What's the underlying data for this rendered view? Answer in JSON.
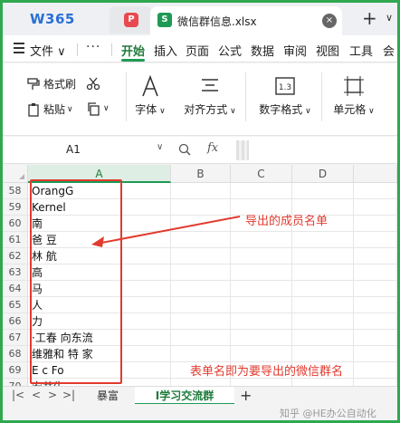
{
  "titlebar": {
    "logo": "W365",
    "pdf_badge": "P",
    "file_tab": {
      "badge": "S",
      "name": "微信群信息.xlsx",
      "close": "×"
    },
    "new_tab": "+",
    "more": "∨"
  },
  "menubar": {
    "file": "文件",
    "more": "···",
    "tabs": [
      "开始",
      "插入",
      "页面",
      "公式",
      "数据",
      "审阅",
      "视图",
      "工具"
    ],
    "active_tab": "开始",
    "extra": "会"
  },
  "ribbon": {
    "format_painter": "格式刷",
    "paste": "粘贴",
    "font": "字体",
    "align": "对齐方式",
    "number_format": "数字格式",
    "cell": "单元格"
  },
  "formula_bar": {
    "cell_ref": "A1",
    "fx": "fx"
  },
  "grid": {
    "columns": [
      "A",
      "B",
      "C",
      "D"
    ],
    "selected_column": "A",
    "rows": [
      {
        "n": "58",
        "a": "OrangG"
      },
      {
        "n": "59",
        "a": "Kernel"
      },
      {
        "n": "60",
        "a": "南"
      },
      {
        "n": "61",
        "a": "爸 豆"
      },
      {
        "n": "62",
        "a": "林 航"
      },
      {
        "n": "63",
        "a": "高"
      },
      {
        "n": "64",
        "a": "马"
      },
      {
        "n": "65",
        "a": "人"
      },
      {
        "n": "66",
        "a": "力"
      },
      {
        "n": "67",
        "a": "·工春 向东流"
      },
      {
        "n": "68",
        "a": "维雅和 特   家"
      },
      {
        "n": "69",
        "a": "E c Fo"
      },
      {
        "n": "70",
        "a": "安井生"
      }
    ]
  },
  "annotations": {
    "exported_members": "导出的成员名单",
    "sheet_name_note": "表单名即为要导出的微信群名"
  },
  "sheets": {
    "tabs": [
      "暴富",
      "I学习交流群"
    ],
    "active": "I学习交流群",
    "add": "+"
  },
  "status": {
    "watermark": "知乎 @HE办公自动化"
  },
  "colors": {
    "accent_green": "#1f9a55",
    "annotation_red": "#e23a2e",
    "frame_green": "#2fa84f"
  }
}
